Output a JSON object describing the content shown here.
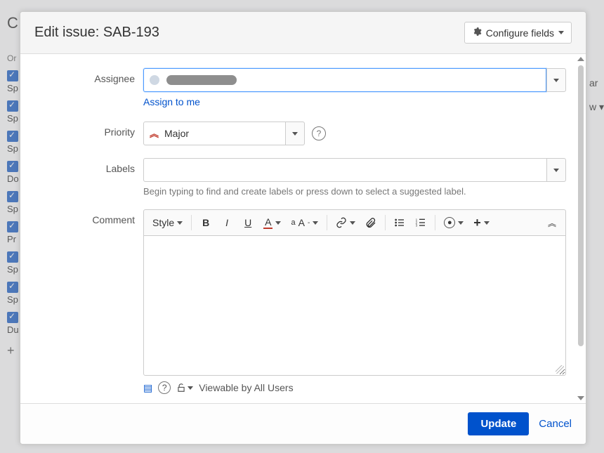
{
  "bg": {
    "right_frag1": "ar",
    "right_frag2": "w ▾",
    "items": [
      "Sp",
      "Sp",
      "Sp",
      "Do",
      "Sp",
      "Pr",
      "Sp",
      "Sp",
      "Du"
    ]
  },
  "header": {
    "title": "Edit issue: SAB-193",
    "configure_label": "Configure fields"
  },
  "fields": {
    "assignee": {
      "label": "Assignee",
      "assign_to_me": "Assign to me"
    },
    "priority": {
      "label": "Priority",
      "value": "Major"
    },
    "labels": {
      "label": "Labels",
      "hint": "Begin typing to find and create labels or press down to select a suggested label."
    },
    "comment": {
      "label": "Comment",
      "style_label": "Style",
      "viewable": "Viewable by All Users"
    }
  },
  "footer": {
    "update": "Update",
    "cancel": "Cancel"
  }
}
